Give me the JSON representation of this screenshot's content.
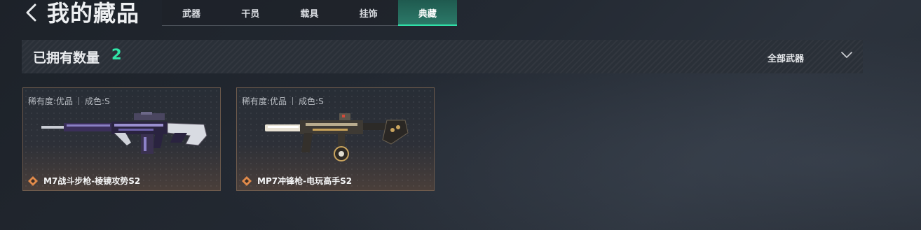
{
  "header": {
    "title": "我的藏品",
    "tabs": [
      {
        "label": "武器",
        "active": false
      },
      {
        "label": "干员",
        "active": false
      },
      {
        "label": "载具",
        "active": false
      },
      {
        "label": "挂饰",
        "active": false
      },
      {
        "label": "典藏",
        "active": true
      }
    ]
  },
  "summary": {
    "owned_label": "已拥有数量",
    "owned_count": "2",
    "filter_label": "全部武器"
  },
  "items": [
    {
      "rarity": "稀有度:优品",
      "condition": "成色:S",
      "name": "M7战斗步枪-棱镜攻势S2"
    },
    {
      "rarity": "稀有度:优品",
      "condition": "成色:S",
      "name": "MP7冲锋枪-电玩高手S2"
    }
  ],
  "colors": {
    "accent": "#31e6a8",
    "quality_orange": "#e08a4a",
    "card_border": "#6d5a4c"
  },
  "icons": {
    "back": "back-arrow-icon",
    "dropdown": "chevron-down-icon",
    "quality": "quality-diamond-icon"
  }
}
